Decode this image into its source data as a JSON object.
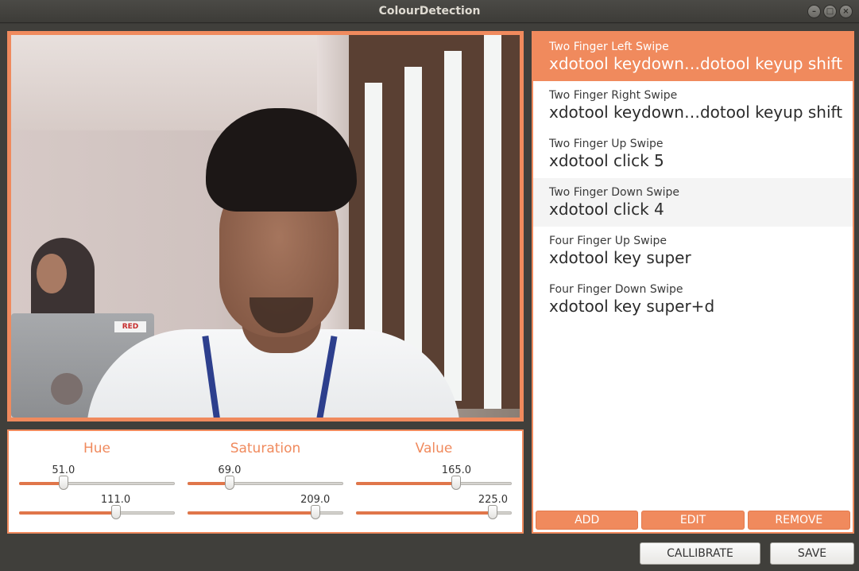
{
  "window": {
    "title": "ColourDetection",
    "controls": [
      "–",
      "□",
      "×"
    ]
  },
  "camera": {
    "laptop_logo": "RED"
  },
  "sliders": {
    "hue": {
      "label": "Hue",
      "low": {
        "value": "51.0",
        "fraction": 0.285
      },
      "high": {
        "value": "111.0",
        "fraction": 0.62
      }
    },
    "saturation": {
      "label": "Saturation",
      "low": {
        "value": "69.0",
        "fraction": 0.27
      },
      "high": {
        "value": "209.0",
        "fraction": 0.82
      }
    },
    "value": {
      "label": "Value",
      "low": {
        "value": "165.0",
        "fraction": 0.645
      },
      "high": {
        "value": "225.0",
        "fraction": 0.88
      }
    }
  },
  "gestures": {
    "items": [
      {
        "name": "Two Finger Left Swipe",
        "command": "xdotool keydown…dotool keyup shift",
        "state": "selected"
      },
      {
        "name": "Two Finger Right Swipe",
        "command": "xdotool keydown…dotool keyup shift",
        "state": ""
      },
      {
        "name": "Two Finger Up Swipe",
        "command": "xdotool click 5",
        "state": ""
      },
      {
        "name": "Two Finger Down Swipe",
        "command": "xdotool click 4",
        "state": "hover"
      },
      {
        "name": "Four Finger Up Swipe",
        "command": "xdotool key super",
        "state": ""
      },
      {
        "name": "Four Finger Down Swipe",
        "command": "xdotool key super+d",
        "state": ""
      }
    ],
    "buttons": {
      "add": "ADD",
      "edit": "EDIT",
      "remove": "REMOVE"
    }
  },
  "footer": {
    "calibrate": "CALLIBRATE",
    "save": "SAVE"
  },
  "colors": {
    "accent": "#f08a5d",
    "window_bg": "#403f3b",
    "list_bg": "#ffffff"
  }
}
